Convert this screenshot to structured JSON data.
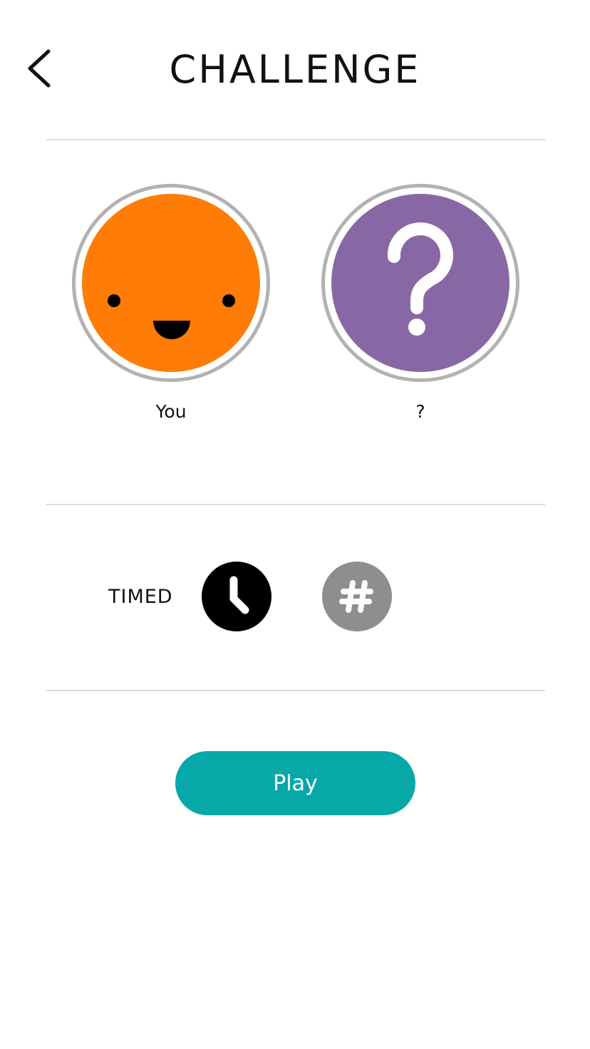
{
  "header": {
    "title": "CHALLENGE",
    "back_icon": "chevron-left-icon"
  },
  "players": [
    {
      "label": "You",
      "avatar": "smiley-face-icon",
      "color": "#ff7c06"
    },
    {
      "label": "?",
      "avatar": "question-mark-icon",
      "color": "#8868a4"
    }
  ],
  "mode": {
    "label": "TIMED",
    "options": [
      {
        "icon": "clock-icon",
        "selected": true,
        "color": "#000000"
      },
      {
        "icon": "hash-icon",
        "selected": false,
        "color": "#8e8e8e"
      }
    ]
  },
  "play_button": {
    "label": "Play",
    "color": "#07a8a8"
  }
}
